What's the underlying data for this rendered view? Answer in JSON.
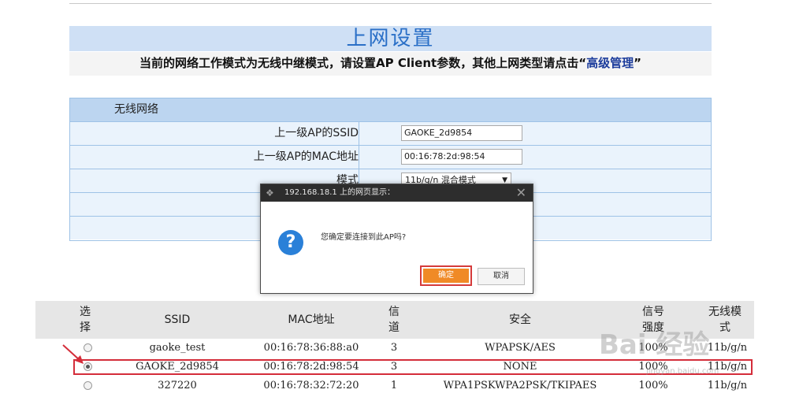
{
  "page": {
    "title": "上网设置",
    "subtitle_prefix": "当前的网络工作模式为无线中继模式，请设置AP Client参数，其他上网类型请点击“",
    "subtitle_link": "高级管理",
    "subtitle_suffix": "”"
  },
  "wireless": {
    "header": "无线网络",
    "ssid_label": "上一级AP的SSID",
    "ssid_value": "GAOKE_2d9854",
    "mac_label": "上一级AP的MAC地址",
    "mac_value": "00:16:78:2d:98:54",
    "mode_label": "模式",
    "mode_value": "11b/g/n 混合模式"
  },
  "dialog": {
    "title": "192.168.18.1 上的网页显示：",
    "message": "您确定要连接到此AP吗?",
    "ok_label": "确定",
    "cancel_label": "取消"
  },
  "ap_table": {
    "headers": {
      "select": "选\n择",
      "ssid": "SSID",
      "mac": "MAC地址",
      "channel": "信\n道",
      "security": "安全",
      "signal": "信号\n强度",
      "mode": "无线模\n式"
    },
    "rows": [
      {
        "ssid": "gaoke_test",
        "mac": "00:16:78:36:88:a0",
        "channel": "3",
        "security": "WPAPSK/AES",
        "signal": "100%",
        "mode": "11b/g/n",
        "selected": false
      },
      {
        "ssid": "GAOKE_2d9854",
        "mac": "00:16:78:2d:98:54",
        "channel": "3",
        "security": "NONE",
        "signal": "100%",
        "mode": "11b/g/n",
        "selected": true
      },
      {
        "ssid": "327220",
        "mac": "00:16:78:32:72:20",
        "channel": "1",
        "security": "WPA1PSKWPA2PSK/TKIPAES",
        "signal": "100%",
        "mode": "11b/g/n",
        "selected": false
      }
    ]
  },
  "watermark": {
    "main": "Bai 经验",
    "sub": "jingyan.baidu.com"
  }
}
